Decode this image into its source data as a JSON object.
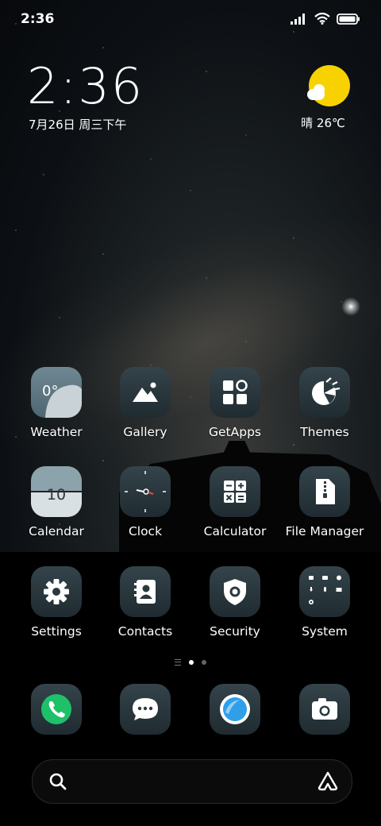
{
  "status_bar": {
    "time": "2:36",
    "icons": [
      "signal-icon",
      "wifi-icon",
      "battery-icon"
    ]
  },
  "clock_widget": {
    "time": "2:36",
    "date": "7月26日 周三下午"
  },
  "weather_widget": {
    "icon": "sun-cloud-icon",
    "text": "晴 26℃"
  },
  "icon_previews": {
    "weather_temp": "0°",
    "calendar_day": "10"
  },
  "apps": [
    {
      "label": "Weather",
      "icon": "weather-icon"
    },
    {
      "label": "Gallery",
      "icon": "gallery-icon"
    },
    {
      "label": "GetApps",
      "icon": "getapps-icon"
    },
    {
      "label": "Themes",
      "icon": "themes-icon"
    },
    {
      "label": "Calendar",
      "icon": "calendar-icon"
    },
    {
      "label": "Clock",
      "icon": "clock-icon"
    },
    {
      "label": "Calculator",
      "icon": "calculator-icon"
    },
    {
      "label": "File Manager",
      "icon": "file-manager-icon"
    },
    {
      "label": "Settings",
      "icon": "settings-icon"
    },
    {
      "label": "Contacts",
      "icon": "contacts-icon"
    },
    {
      "label": "Security",
      "icon": "security-icon"
    },
    {
      "label": "System",
      "icon": "system-folder-icon"
    }
  ],
  "page_indicator": {
    "pages": 2,
    "current": 1
  },
  "dock": [
    {
      "icon": "phone-icon"
    },
    {
      "icon": "messages-icon"
    },
    {
      "icon": "browser-icon"
    },
    {
      "icon": "camera-icon"
    }
  ],
  "search_bar": {
    "left_icon": "search-icon",
    "right_icon": "app-vault-icon"
  },
  "colors": {
    "sun": "#f7d200",
    "phone_green": "#1fc06a",
    "browser_blue": "#2f9fea",
    "icon_bg": "#2a393e"
  }
}
